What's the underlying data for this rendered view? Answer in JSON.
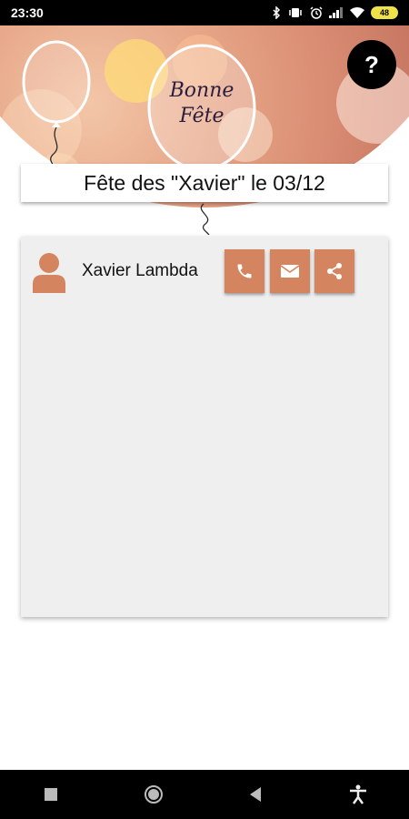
{
  "status_bar": {
    "time": "23:30",
    "battery": "48",
    "icons": [
      "bluetooth-icon",
      "vibrate-icon",
      "alarm-icon",
      "signal-icon",
      "wifi-icon",
      "battery-icon"
    ]
  },
  "header": {
    "balloon_text_line1": "Bonne",
    "balloon_text_line2": "Fête",
    "help_icon": "question-icon",
    "title": "Fête des \"Xavier\" le 03/12"
  },
  "contact": {
    "avatar_icon": "person-icon",
    "name": "Xavier Lambda",
    "actions": [
      {
        "icon": "phone-icon"
      },
      {
        "icon": "email-icon"
      },
      {
        "icon": "share-icon"
      }
    ]
  },
  "colors": {
    "accent": "#d4845f",
    "card_bg": "#efefef",
    "header_bg": "#d98d73"
  },
  "nav_bar": {
    "buttons": [
      "recent-apps-icon",
      "home-icon",
      "back-icon",
      "accessibility-icon"
    ]
  }
}
